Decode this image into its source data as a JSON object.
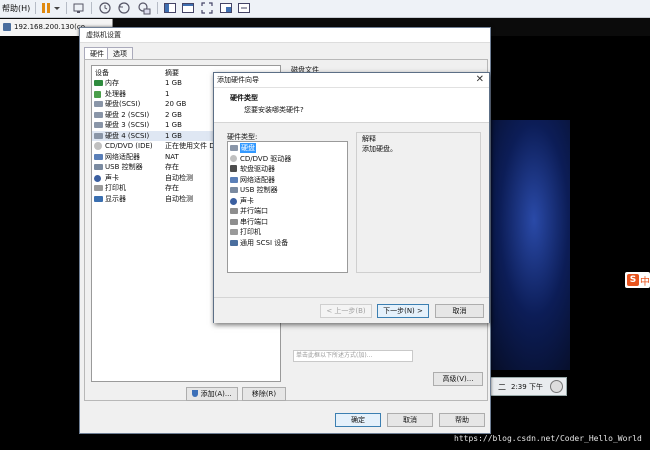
{
  "host_toolbar": {
    "menu_help": "帮助(H)",
    "icons": [
      "pause-icon",
      "dropdown-icon",
      "send-keys-icon",
      "snapshot-icon",
      "revert-snapshot-icon",
      "snapshot-manager-icon",
      "console-view-icon",
      "unity-icon",
      "fullscreen-icon",
      "thumbnail-icon",
      "autofit-icon"
    ]
  },
  "vm_tab": {
    "label": "192.168.200.130(co"
  },
  "settings": {
    "title": "虚拟机设置",
    "tabs": [
      {
        "label": "硬件",
        "active": true
      },
      {
        "label": "选项",
        "active": false
      }
    ],
    "columns": {
      "device": "设备",
      "summary": "摘要"
    },
    "devices": [
      {
        "name": "内存",
        "summary": "1 GB",
        "icon": "memory-icon"
      },
      {
        "name": "处理器",
        "summary": "1",
        "icon": "cpu-icon"
      },
      {
        "name": "硬盘(SCSI)",
        "summary": "20 GB",
        "icon": "hard-disk-icon"
      },
      {
        "name": "硬盘 2 (SCSI)",
        "summary": "2 GB",
        "icon": "hard-disk-icon"
      },
      {
        "name": "硬盘 3 (SCSI)",
        "summary": "1 GB",
        "icon": "hard-disk-icon"
      },
      {
        "name": "硬盘 4 (SCSI)",
        "summary": "1 GB",
        "icon": "hard-disk-icon",
        "selected": true
      },
      {
        "name": "CD/DVD (IDE)",
        "summary": "正在使用文件 D",
        "icon": "cd-dvd-icon"
      },
      {
        "name": "网络适配器",
        "summary": "NAT",
        "icon": "network-adapter-icon"
      },
      {
        "name": "USB 控制器",
        "summary": "存在",
        "icon": "usb-icon"
      },
      {
        "name": "声卡",
        "summary": "自动检测",
        "icon": "sound-card-icon"
      },
      {
        "name": "打印机",
        "summary": "存在",
        "icon": "printer-icon"
      },
      {
        "name": "显示器",
        "summary": "自动检测",
        "icon": "display-icon"
      }
    ],
    "disk_file_label": "磁盘文件",
    "behind_field_text": "单击此框以下所述方式(加)...",
    "buttons": {
      "add": "添加(A)...",
      "remove": "移除(R)",
      "advanced": "高级(V)...",
      "ok": "确定",
      "cancel": "取消",
      "help": "帮助"
    }
  },
  "wizard": {
    "title": "添加硬件向导",
    "heading": "硬件类型",
    "subheading": "您要安装哪类硬件?",
    "list_label": "硬件类型:",
    "items": [
      {
        "label": "硬盘",
        "icon": "hard-disk-icon",
        "selected": true
      },
      {
        "label": "CD/DVD 驱动器",
        "icon": "cd-dvd-icon"
      },
      {
        "label": "软盘驱动器",
        "icon": "floppy-icon"
      },
      {
        "label": "网络适配器",
        "icon": "network-adapter-icon"
      },
      {
        "label": "USB 控制器",
        "icon": "usb-icon"
      },
      {
        "label": "声卡",
        "icon": "sound-card-icon"
      },
      {
        "label": "并行端口",
        "icon": "parallel-port-icon"
      },
      {
        "label": "串行端口",
        "icon": "serial-port-icon"
      },
      {
        "label": "打印机",
        "icon": "printer-icon"
      },
      {
        "label": "通用 SCSI 设备",
        "icon": "scsi-icon"
      }
    ],
    "explain_label": "解释",
    "explain_text": "添加硬盘。",
    "buttons": {
      "back": "< 上一步(B)",
      "next": "下一步(N) >",
      "cancel": "取消"
    }
  },
  "taskbar": {
    "ime": "二",
    "time": "2:39 下午"
  },
  "sogou": {
    "text": "中"
  },
  "watermark": "https://blog.csdn.net/Coder_Hello_World",
  "colors": {
    "selection": "#3399ff",
    "desktop": "#000000",
    "accent": "#3c7fb1"
  }
}
